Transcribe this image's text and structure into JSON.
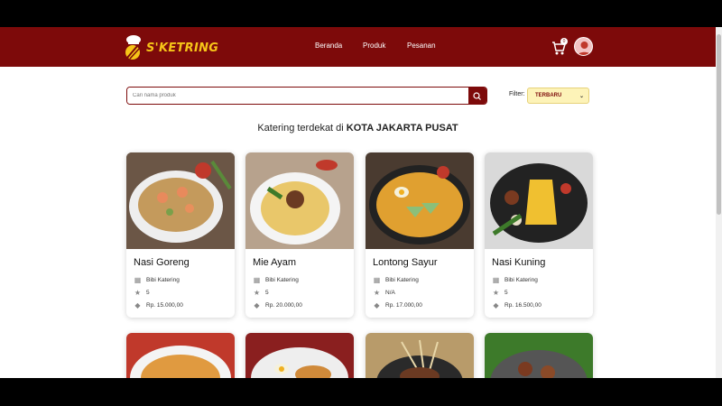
{
  "brand": {
    "name": "S'KETRING"
  },
  "nav": {
    "items": [
      "Beranda",
      "Produk",
      "Pesanan"
    ]
  },
  "cart": {
    "count": "0"
  },
  "search": {
    "placeholder": "Cari nama produk"
  },
  "filter": {
    "label": "Filter:",
    "selected": "TERBARU"
  },
  "heading": {
    "prefix": "Katering terdekat di",
    "city": "KOTA JAKARTA PUSAT"
  },
  "products": [
    {
      "name": "Nasi Goreng",
      "vendor": "Bibi Katering",
      "rating": "5",
      "price": "Rp. 15.000,00"
    },
    {
      "name": "Mie Ayam",
      "vendor": "Bibi Katering",
      "rating": "5",
      "price": "Rp. 20.000,00"
    },
    {
      "name": "Lontong Sayur",
      "vendor": "Bibi Katering",
      "rating": "N/A",
      "price": "Rp. 17.000,00"
    },
    {
      "name": "Nasi Kuning",
      "vendor": "Bibi Katering",
      "rating": "5",
      "price": "Rp. 16.500,00"
    }
  ],
  "colors": {
    "primary": "#7d0a0a",
    "accent": "#f6c518",
    "filter_bg": "#fdf3b8"
  },
  "icons": {
    "vendor": "store-icon",
    "rating": "star-icon",
    "price": "tag-icon",
    "cart": "cart-icon",
    "search": "search-icon"
  }
}
